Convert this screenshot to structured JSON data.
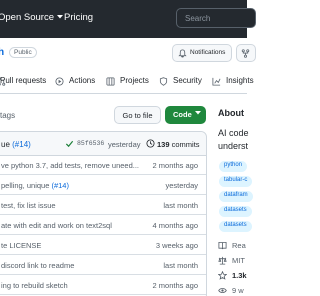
{
  "header": {
    "nav": [
      "Open Source",
      "Pricing"
    ],
    "search_placeholder": "Search"
  },
  "repo": {
    "name_fragment": "h",
    "visibility": "Public",
    "notifications_label": "Notifications"
  },
  "tabs": [
    {
      "label": "Pull requests",
      "icon": "pull-request-icon"
    },
    {
      "label": "Actions",
      "icon": "actions-icon"
    },
    {
      "label": "Projects",
      "icon": "projects-icon"
    },
    {
      "label": "Security",
      "icon": "shield-icon"
    },
    {
      "label": "Insights",
      "icon": "graph-icon"
    }
  ],
  "toolbar": {
    "tags_text": "tags",
    "go_to_file": "Go to file",
    "code_button": "Code"
  },
  "latest_commit": {
    "message": "ue ",
    "link": "(#14)",
    "sha": "85f6536",
    "time": "yesterday",
    "count": "139",
    "count_label": "commits"
  },
  "file_rows": [
    {
      "message": "ve python 3.7, add tests, remove uneed...",
      "link": "",
      "time": "2 months ago"
    },
    {
      "message": "pelling, unique ",
      "link": "(#14)",
      "time": "yesterday"
    },
    {
      "message": "test, fix list issue",
      "link": "",
      "time": "last month"
    },
    {
      "message": "ate with edit and work on text2sql",
      "link": "",
      "time": "4 months ago"
    },
    {
      "message": "te LICENSE",
      "link": "",
      "time": "3 weeks ago"
    },
    {
      "message": "discord link to readme",
      "link": "",
      "time": "last month"
    },
    {
      "message": "ing to rebuild sketch",
      "link": "",
      "time": "2 months ago"
    }
  ],
  "about": {
    "title": "About",
    "description_line1": "AI code",
    "description_line2": "underst",
    "topics": [
      "python",
      "tabular-c",
      "datafram",
      "datasets",
      "datasets"
    ],
    "readme": "Rea",
    "license": "MIT",
    "stars": "1.3k",
    "watching": "9 w"
  },
  "colors": {
    "header_bg": "#24292f",
    "link": "#0969da",
    "code_button": "#1f883d",
    "topic_bg": "#ddf4ff"
  }
}
